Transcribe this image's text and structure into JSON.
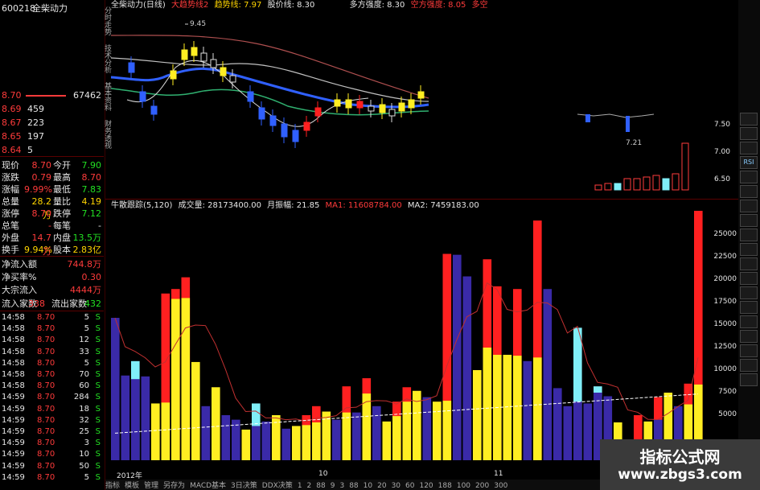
{
  "stock": {
    "code": "600218",
    "name": "全柴动力"
  },
  "orderbook": {
    "top_price": "8.70",
    "top_vol": "67462",
    "levels": [
      {
        "price": "8.69",
        "vol": "459"
      },
      {
        "price": "8.67",
        "vol": "223"
      },
      {
        "price": "8.65",
        "vol": "197"
      },
      {
        "price": "8.64",
        "vol": "5"
      }
    ]
  },
  "quote": [
    {
      "l1": "现价",
      "v1": "8.70",
      "l2": "今开",
      "v2": "7.90"
    },
    {
      "l1": "涨跌",
      "v1": "0.79",
      "l2": "最高",
      "v2": "8.70"
    },
    {
      "l1": "涨幅",
      "v1": "9.99%",
      "l2": "最低",
      "v2": "7.83"
    },
    {
      "l1": "总量",
      "v1": "28.2万",
      "l2": "量比",
      "v2": "4.19"
    },
    {
      "l1": "涨停",
      "v1": "8.70",
      "l2": "跌停",
      "v2": "7.12"
    },
    {
      "l1": "总笔",
      "v1": "-",
      "l2": "每笔",
      "v2": "-"
    },
    {
      "l1": "外盘",
      "v1": "14.7万",
      "l2": "内盘",
      "v2": "13.5万"
    }
  ],
  "turnover": {
    "l1": "换手",
    "v1": "9.94%",
    "l2": "股本",
    "v2": "2.83亿"
  },
  "flow": [
    {
      "label": "净流入额",
      "value": "744.8万"
    },
    {
      "label": "净买率%",
      "value": "0.30"
    },
    {
      "label": "大宗流入",
      "value": "4444万"
    }
  ],
  "flow_count": {
    "l1": "流入家数",
    "v1": "338",
    "l2": "流出家数",
    "v2": "432"
  },
  "ticks": [
    {
      "t": "14:58",
      "p": "8.70",
      "v": "5",
      "s": "S"
    },
    {
      "t": "14:58",
      "p": "8.70",
      "v": "5",
      "s": "S"
    },
    {
      "t": "14:58",
      "p": "8.70",
      "v": "12",
      "s": "S"
    },
    {
      "t": "14:58",
      "p": "8.70",
      "v": "33",
      "s": "S"
    },
    {
      "t": "14:58",
      "p": "8.70",
      "v": "5",
      "s": "S"
    },
    {
      "t": "14:58",
      "p": "8.70",
      "v": "70",
      "s": "S"
    },
    {
      "t": "14:58",
      "p": "8.70",
      "v": "60",
      "s": "S"
    },
    {
      "t": "14:59",
      "p": "8.70",
      "v": "284",
      "s": "S"
    },
    {
      "t": "14:59",
      "p": "8.70",
      "v": "18",
      "s": "S"
    },
    {
      "t": "14:59",
      "p": "8.70",
      "v": "32",
      "s": "S"
    },
    {
      "t": "14:59",
      "p": "8.70",
      "v": "25",
      "s": "S"
    },
    {
      "t": "14:59",
      "p": "8.70",
      "v": "3",
      "s": "S"
    },
    {
      "t": "14:59",
      "p": "8.70",
      "v": "10",
      "s": "S"
    },
    {
      "t": "14:59",
      "p": "8.70",
      "v": "50",
      "s": "S"
    },
    {
      "t": "14:59",
      "p": "8.70",
      "v": "5",
      "s": "S"
    }
  ],
  "vtabs": [
    "分时走势",
    "技术分析",
    "基本资料",
    "财务透视"
  ],
  "top_header": {
    "title": "全柴动力(日线)",
    "ind": "大趋势线2",
    "trend": "趋势线: 7.97",
    "price_line": "股价线: 8.30",
    "bull": "多方强度: 8.30",
    "bear": "空方强度: 8.05",
    "bull2": "多空"
  },
  "price_annotation_high": "9.45",
  "price_annotation_low": "7.21",
  "price_axis": [
    "7.50",
    "7.00",
    "6.50"
  ],
  "vol_header": {
    "title": "牛散跟踪(5,120)",
    "vol": "成交量: 28173400.00",
    "amp": "月振幅: 21.85",
    "ma1": "MA1: 11608784.00",
    "ma2": "MA2: 7459183.00"
  },
  "vol_axis": [
    "25000",
    "22500",
    "20000",
    "17500",
    "15000",
    "12500",
    "10000",
    "7500",
    "5000"
  ],
  "time_labels": [
    "2012年",
    "10",
    "11"
  ],
  "bottom_tabs": [
    "指标",
    "模板",
    "管理",
    "另存为",
    "MACD基本",
    "3日决策",
    "DDX决策",
    "1",
    "2",
    "88",
    "9",
    "3",
    "88",
    "10",
    "20",
    "30",
    "60",
    "120",
    "188",
    "100",
    "200",
    "300"
  ],
  "right_tools": [
    "",
    "",
    "",
    "RSI",
    "",
    "",
    "",
    "",
    "",
    "",
    "",
    "",
    "",
    "",
    "",
    "",
    "",
    "",
    ""
  ],
  "watermark": {
    "line1": "指标公式网",
    "line2": "www.zbgs3.com"
  },
  "colors": {
    "red": "#ff2020",
    "yellow": "#ffee22",
    "blue": "#3a2aa8",
    "cyan": "#80eef8"
  },
  "chart_data": {
    "type": "bar",
    "title": "牛散跟踪(5,120)",
    "ylim": [
      0,
      27500
    ],
    "ticks": [
      25000,
      22500,
      20000,
      17500,
      15000,
      12500,
      10000,
      7500,
      5000
    ],
    "bars": [
      {
        "c": "blue",
        "v": 15800
      },
      {
        "c": "blue",
        "v": 9400
      },
      {
        "c": "blue",
        "v": 9000,
        "top": "cyan",
        "tv": 11000
      },
      {
        "c": "blue",
        "v": 9300
      },
      {
        "c": "yellow",
        "v": 6300
      },
      {
        "c": "yellow",
        "v": 6400,
        "top": "red",
        "tv": 18500
      },
      {
        "c": "yellow",
        "v": 17900,
        "top": "red",
        "tv": 19000
      },
      {
        "c": "yellow",
        "v": 18000,
        "top": "red",
        "tv": 20300
      },
      {
        "c": "yellow",
        "v": 10900
      },
      {
        "c": "blue",
        "v": 6000
      },
      {
        "c": "yellow",
        "v": 8100
      },
      {
        "c": "blue",
        "v": 5000
      },
      {
        "c": "blue",
        "v": 4500
      },
      {
        "c": "yellow",
        "v": 3400
      },
      {
        "c": "blue",
        "v": 3800,
        "top": "cyan",
        "tv": 6300
      },
      {
        "c": "blue",
        "v": 4300
      },
      {
        "c": "yellow",
        "v": 5000
      },
      {
        "c": "blue",
        "v": 3500
      },
      {
        "c": "yellow",
        "v": 3800
      },
      {
        "c": "yellow",
        "v": 3900,
        "top": "red",
        "tv": 5000
      },
      {
        "c": "yellow",
        "v": 4200,
        "top": "red",
        "tv": 6000
      },
      {
        "c": "yellow",
        "v": 5400
      },
      {
        "c": "blue",
        "v": 4500
      },
      {
        "c": "yellow",
        "v": 5300,
        "top": "red",
        "tv": 8200
      },
      {
        "c": "blue",
        "v": 5300
      },
      {
        "c": "yellow",
        "v": 7400,
        "top": "red",
        "tv": 9100
      },
      {
        "c": "blue",
        "v": 6000
      },
      {
        "c": "yellow",
        "v": 4300
      },
      {
        "c": "yellow",
        "v": 4900,
        "top": "red",
        "tv": 6500
      },
      {
        "c": "yellow",
        "v": 6500,
        "top": "red",
        "tv": 8100
      },
      {
        "c": "yellow",
        "v": 7700
      },
      {
        "c": "blue",
        "v": 7000
      },
      {
        "c": "yellow",
        "v": 6500
      },
      {
        "c": "yellow",
        "v": 6600,
        "top": "red",
        "tv": 22900
      },
      {
        "c": "blue",
        "v": 22800
      },
      {
        "c": "blue",
        "v": 20400
      },
      {
        "c": "yellow",
        "v": 10000
      },
      {
        "c": "yellow",
        "v": 12500,
        "top": "red",
        "tv": 22300
      },
      {
        "c": "yellow",
        "v": 11700,
        "top": "red",
        "tv": 19300
      },
      {
        "c": "yellow",
        "v": 11700
      },
      {
        "c": "yellow",
        "v": 11600,
        "top": "red",
        "tv": 19000
      },
      {
        "c": "blue",
        "v": 11000
      },
      {
        "c": "yellow",
        "v": 11400,
        "top": "red",
        "tv": 26600
      },
      {
        "c": "blue",
        "v": 19000
      },
      {
        "c": "blue",
        "v": 8000
      },
      {
        "c": "blue",
        "v": 6000
      },
      {
        "c": "blue",
        "v": 6500,
        "top": "cyan",
        "tv": 14700
      },
      {
        "c": "blue",
        "v": 6300
      },
      {
        "c": "blue",
        "v": 7500,
        "top": "cyan",
        "tv": 8200
      },
      {
        "c": "blue",
        "v": 7100
      },
      {
        "c": "yellow",
        "v": 4200
      },
      {
        "c": "yellow",
        "v": 2100
      },
      {
        "c": "yellow",
        "v": 2000,
        "top": "red",
        "tv": 5000
      },
      {
        "c": "yellow",
        "v": 4300
      },
      {
        "c": "blue",
        "v": 4500,
        "top": "red",
        "tv": 7000
      },
      {
        "c": "yellow",
        "v": 7500
      },
      {
        "c": "blue",
        "v": 6000
      },
      {
        "c": "yellow",
        "v": 6200,
        "top": "red",
        "tv": 8500
      },
      {
        "c": "yellow",
        "v": 8400,
        "top": "red",
        "tv": 28000
      }
    ]
  }
}
